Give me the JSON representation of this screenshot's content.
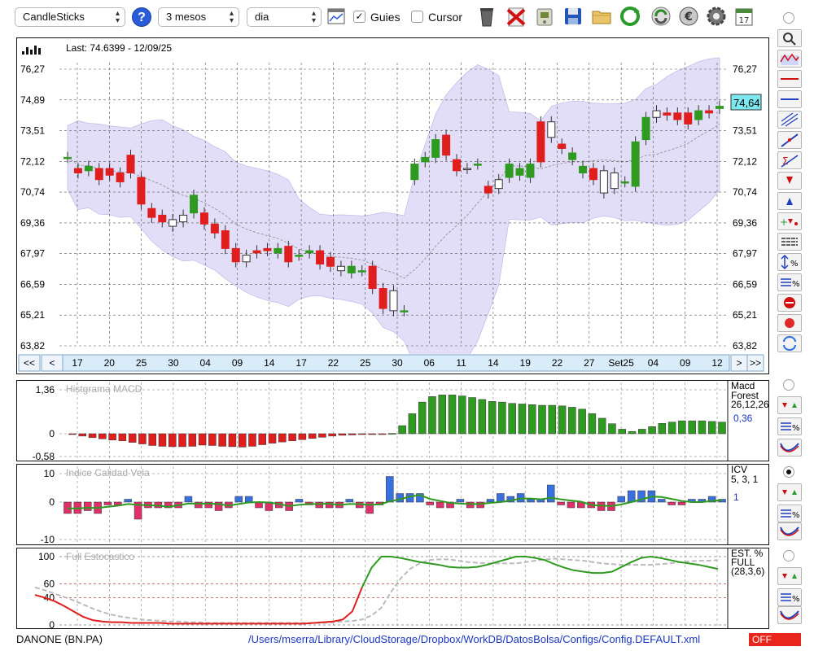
{
  "toolbar": {
    "chart_type": "CandleSticks",
    "help": "?",
    "period": "3 mesos",
    "interval": "dia",
    "guies_label": "Guies",
    "guies_checked": true,
    "cursor_label": "Cursor",
    "cursor_checked": false,
    "icons": [
      "trash-icon",
      "delete-icon",
      "device-icon",
      "save-icon",
      "folder-icon",
      "refresh-icon",
      "sync-icon",
      "euro-icon",
      "gear-icon",
      "calendar-icon"
    ],
    "calendar_day": "17"
  },
  "main_chart": {
    "last_label": "Last: 74.6399 - 12/09/25",
    "price_ticks": [
      "76,27",
      "74,89",
      "73,51",
      "72,12",
      "70,74",
      "69,36",
      "67,97",
      "66,59",
      "65,21",
      "63,82"
    ],
    "last_price": "74,64",
    "date_labels": [
      "17",
      "20",
      "25",
      "30",
      "04",
      "09",
      "14",
      "17",
      "22",
      "25",
      "30",
      "06",
      "11",
      "14",
      "19",
      "22",
      "27",
      "Set25",
      "04",
      "09",
      "12"
    ],
    "nav": {
      "first": "<<",
      "prev": "<",
      "next": ">",
      "last": ">>"
    }
  },
  "macd": {
    "title": "Histgrama MACD",
    "ticks": [
      "1,36",
      "0",
      "-0,58"
    ],
    "name": "Macd",
    "name2": "Forest",
    "params": "26,12,26",
    "value": "0,36"
  },
  "icv": {
    "title": "Indice Calidad Vela",
    "ticks": [
      "10",
      "0",
      "-10"
    ],
    "name": "ICV",
    "params": "5, 3, 1",
    "value": "1"
  },
  "stoch": {
    "title": "Full Estocastico",
    "ticks": [
      "100",
      "60",
      "40",
      "0"
    ],
    "name": "EST. %",
    "name2": "FULL",
    "params": "(28,3,6)"
  },
  "status": {
    "ticker": "DANONE (BN.PA)",
    "path": "/Users/mserra/Library/CloudStorage/Dropbox/WorkDB/DatosBolsa/Configs/Config.DEFAULT.xml",
    "off": "OFF"
  },
  "colors": {
    "up": "#2e9a1f",
    "down": "#e01e1e",
    "band": "#d4cdf5",
    "panel_bg": "#ffffff",
    "icv_pos": "#3a6fe0",
    "icv_neg": "#e0306a",
    "link": "#1a36c8"
  },
  "chart_data": [
    {
      "type": "candlestick",
      "title": "DANONE (BN.PA)",
      "ylim": [
        63.82,
        76.27
      ],
      "x": [
        "17",
        "18",
        "19",
        "20",
        "23",
        "24",
        "25",
        "26",
        "27",
        "30",
        "01",
        "02",
        "03",
        "04",
        "07",
        "08",
        "09",
        "10",
        "11",
        "14",
        "15",
        "16",
        "17",
        "18",
        "21",
        "22",
        "23",
        "24",
        "25",
        "28",
        "29",
        "30",
        "31",
        "01",
        "04",
        "05",
        "06",
        "07",
        "08",
        "11",
        "12",
        "13",
        "14",
        "15",
        "18",
        "19",
        "20",
        "21",
        "22",
        "25",
        "26",
        "27",
        "28",
        "29",
        "Set25",
        "02",
        "03",
        "04",
        "05",
        "08",
        "09",
        "10",
        "11",
        "12"
      ],
      "open": [
        72.3,
        71.8,
        71.7,
        71.8,
        71.8,
        71.6,
        72.4,
        71.4,
        70.0,
        69.7,
        69.2,
        69.4,
        69.8,
        69.8,
        69.3,
        69.0,
        68.2,
        67.6,
        68.1,
        68.2,
        68.0,
        68.3,
        67.9,
        68.0,
        68.1,
        67.8,
        67.2,
        67.1,
        67.2,
        67.4,
        66.4,
        65.4,
        65.4,
        71.3,
        72.1,
        72.3,
        73.3,
        72.2,
        71.8,
        72.0,
        71.0,
        70.9,
        71.4,
        71.5,
        71.4,
        73.9,
        73.2,
        72.9,
        72.2,
        71.6,
        71.8,
        70.7,
        70.9,
        71.2,
        71.0,
        73.1,
        74.1,
        74.3,
        74.3,
        74.3,
        74.0,
        74.4,
        74.5
      ],
      "close": [
        72.3,
        71.6,
        71.9,
        71.3,
        71.5,
        71.2,
        71.6,
        70.2,
        69.6,
        69.4,
        69.5,
        69.7,
        70.6,
        69.3,
        68.9,
        68.2,
        67.6,
        67.9,
        68.0,
        68.1,
        68.2,
        67.6,
        67.9,
        68.1,
        67.5,
        67.4,
        67.4,
        67.4,
        67.2,
        66.4,
        65.5,
        66.3,
        65.4,
        72.0,
        72.3,
        73.1,
        72.4,
        71.7,
        71.8,
        72.0,
        70.7,
        71.3,
        72.0,
        71.8,
        72.0,
        72.1,
        73.9,
        72.7,
        72.5,
        71.9,
        71.3,
        71.7,
        71.6,
        71.2,
        73.0,
        74.1,
        74.4,
        74.2,
        74.0,
        73.8,
        74.4,
        74.3,
        74.6
      ]
    },
    {
      "type": "bar",
      "title": "Histgrama MACD",
      "ylim": [
        -0.58,
        1.36
      ],
      "values": [
        -0.02,
        -0.06,
        -0.1,
        -0.13,
        -0.16,
        -0.18,
        -0.22,
        -0.26,
        -0.3,
        -0.32,
        -0.33,
        -0.33,
        -0.32,
        -0.29,
        -0.3,
        -0.32,
        -0.33,
        -0.34,
        -0.32,
        -0.28,
        -0.24,
        -0.21,
        -0.18,
        -0.15,
        -0.12,
        -0.09,
        -0.06,
        -0.04,
        -0.03,
        -0.02,
        -0.01,
        -0.01,
        0.01,
        0.25,
        0.62,
        0.98,
        1.15,
        1.2,
        1.2,
        1.17,
        1.12,
        1.06,
        1.0,
        0.98,
        0.94,
        0.92,
        0.9,
        0.88,
        0.88,
        0.86,
        0.82,
        0.76,
        0.62,
        0.48,
        0.31,
        0.14,
        0.07,
        0.14,
        0.22,
        0.32,
        0.36,
        0.4,
        0.4,
        0.4,
        0.38,
        0.36
      ]
    },
    {
      "type": "bar",
      "title": "Indice Calidad Vela",
      "ylim": [
        -10,
        10
      ],
      "values": [
        -4,
        -4,
        -3,
        -4,
        -1,
        -1,
        1,
        -6,
        -2,
        -2,
        -2,
        -2,
        2,
        -2,
        -2,
        -3,
        -2,
        2,
        2,
        -2,
        -3,
        -2,
        -3,
        1,
        -1,
        -2,
        -2,
        -2,
        1,
        -2,
        -4,
        -1,
        9,
        3,
        3,
        3,
        -1,
        -2,
        -2,
        1,
        -2,
        -2,
        1,
        3,
        2,
        3,
        1,
        1,
        6,
        -1,
        -2,
        -2,
        -2,
        -3,
        -3,
        2,
        4,
        4,
        4,
        1,
        -1,
        -1,
        1,
        1,
        2,
        1
      ]
    },
    {
      "type": "line",
      "title": "Full Estocastico",
      "ylim": [
        0,
        100
      ],
      "series": [
        {
          "values": [
            44,
            40,
            35,
            28,
            20,
            12,
            7,
            5,
            4,
            4,
            3,
            3,
            3,
            3,
            2,
            2,
            2,
            2,
            2,
            2,
            2,
            2,
            2,
            2,
            2,
            2,
            2,
            2,
            2,
            3,
            4,
            5,
            8,
            20,
            55,
            84,
            100,
            100,
            98,
            95,
            92,
            90,
            88,
            85,
            84,
            84,
            85,
            88,
            92,
            96,
            100,
            100,
            98,
            95,
            89,
            84,
            80,
            78,
            76,
            76,
            78,
            85,
            92,
            98,
            100,
            98,
            95,
            92,
            90,
            88,
            85,
            82
          ]
        },
        {
          "values": [
            55,
            51,
            46,
            41,
            36,
            30,
            24,
            19,
            15,
            12,
            10,
            8,
            7,
            6,
            5,
            5,
            4,
            4,
            3,
            3,
            3,
            3,
            3,
            3,
            3,
            3,
            3,
            3,
            3,
            3,
            3,
            4,
            5,
            6,
            8,
            14,
            25,
            48,
            68,
            82,
            90,
            95,
            96,
            96,
            94,
            92,
            91,
            90,
            90,
            90,
            90,
            92,
            94,
            96,
            97,
            96,
            95,
            94,
            92,
            90,
            89,
            88,
            88,
            88,
            88,
            89,
            90,
            92,
            93,
            94,
            94,
            95
          ]
        }
      ]
    }
  ]
}
